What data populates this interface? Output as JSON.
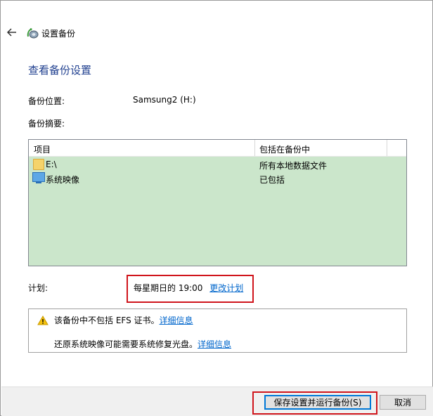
{
  "window": {
    "title": "设置备份"
  },
  "page": {
    "heading": "查看备份设置"
  },
  "location": {
    "label": "备份位置:",
    "value": "Samsung2 (H:)"
  },
  "summary": {
    "label": "备份摘要:",
    "columns": [
      "项目",
      "包括在备份中"
    ],
    "rows": [
      {
        "item": "E:\\",
        "included": "所有本地数据文件",
        "icon": "folder-icon"
      },
      {
        "item": "系统映像",
        "included": "已包括",
        "icon": "monitor-icon"
      }
    ]
  },
  "schedule": {
    "label": "计划:",
    "value": "每星期日的 19:00",
    "change_link": "更改计划"
  },
  "notices": {
    "efs_text": "该备份中不包括 EFS 证书。",
    "efs_link": "详细信息",
    "repair_text": "还原系统映像可能需要系统修复光盘。",
    "repair_link": "详细信息"
  },
  "buttons": {
    "save_run": "保存设置并运行备份(S)",
    "cancel": "取消"
  },
  "colors": {
    "table_bg": "#cbe6cb",
    "heading": "#1f3f8f",
    "link": "#0066cc",
    "highlight": "#d0151c"
  }
}
